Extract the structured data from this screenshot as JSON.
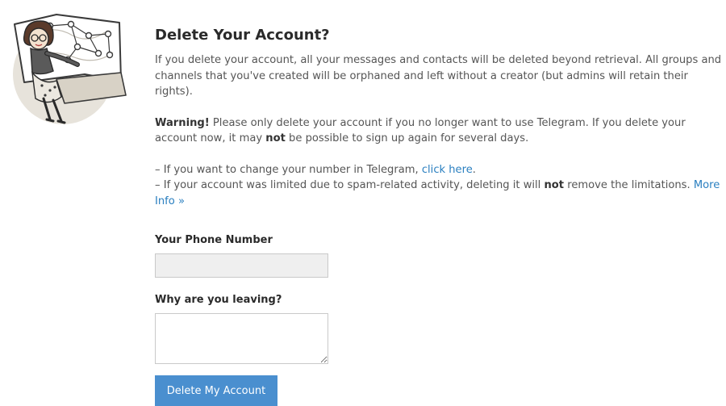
{
  "page": {
    "title": "Delete Your Account?"
  },
  "intro": {
    "text": "If you delete your account, all your messages and contacts will be deleted beyond retrieval. All groups and channels that you've created will be orphaned and left without a creator (but admins will retain their rights)."
  },
  "warning": {
    "label": "Warning!",
    "text_before": " Please only delete your account if you no longer want to use Telegram. If you delete your account now, it may ",
    "emphasis": "not",
    "text_after": " be possible to sign up again for several days."
  },
  "notes": {
    "line1_prefix": "– If you want to change your number in Telegram, ",
    "line1_link": "click here",
    "line1_suffix": ".",
    "line2_prefix": "– If your account was limited due to spam-related activity, deleting it will ",
    "line2_emphasis": "not",
    "line2_middle": " remove the limitations. ",
    "line2_link": "More Info »"
  },
  "form": {
    "phone_label": "Your Phone Number",
    "phone_value": "",
    "reason_label": "Why are you leaving?",
    "reason_value": "",
    "submit_label": "Delete My Account"
  },
  "colors": {
    "link": "#2a7fc0",
    "button": "#4a8fcf",
    "input_disabled_bg": "#efefef"
  },
  "icons": {
    "illustration": "telegram-woman-at-map-illustration"
  }
}
